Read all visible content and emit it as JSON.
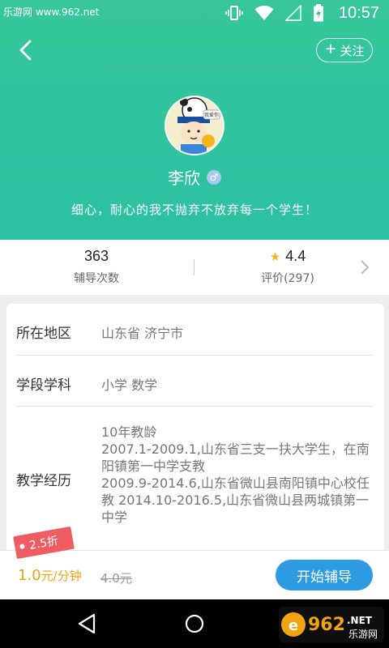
{
  "status_bar": {
    "watermark": "乐游网 www.962.net",
    "time": "10:57"
  },
  "header": {
    "follow_label": "关注",
    "teacher_name": "李欣",
    "gender_symbol": "♂",
    "motto": "细心，耐心的我不抛弃不放弃每一个学生！",
    "avatar_caption": "我爱你"
  },
  "stats": {
    "sessions_value": "363",
    "sessions_label": "辅导次数",
    "rating_value": "4.4",
    "rating_label": "评价(297)"
  },
  "profile": {
    "region_label": "所在地区",
    "region_value": "山东省 济宁市",
    "subject_label": "学段学科",
    "subject_value": "小学 数学",
    "experience_label": "教学经历",
    "experience_text": "10年教龄\n2007.1-2009.1,山东省三支一扶大学生，在南阳镇第一中学支教\n2009.9-2014.6,山东省微山县南阳镇中心校任教    2014.10-2016.5,山东省微山县两城镇第一中学"
  },
  "bottom_bar": {
    "discount_tag": "2.5折",
    "price": "1.0",
    "price_unit": "元/分钟",
    "old_price": "4.0元",
    "start_button": "开始辅导"
  },
  "logo": {
    "text": "962",
    "sub": "乐游网",
    "net": ".NET"
  },
  "colors": {
    "header": "#33c49f",
    "accent_blue": "#2d9be2",
    "price_orange": "#f3a112",
    "tag_red": "#ef5d63",
    "star": "#f5b51e"
  }
}
